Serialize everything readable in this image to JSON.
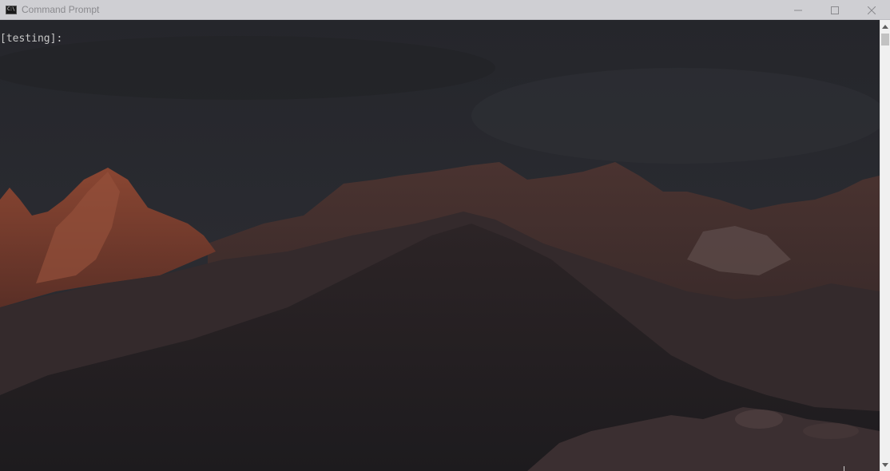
{
  "window": {
    "title": "Command Prompt",
    "icon": "cmd-app-icon",
    "icon_text": "C:\\",
    "controls": {
      "minimize": "minimize-icon",
      "maximize": "maximize-icon",
      "close": "close-icon"
    }
  },
  "console": {
    "prompt": "[testing]:",
    "background": "mountain-sunset-wallpaper"
  },
  "colors": {
    "titlebar": "#cfcfd3",
    "title_text": "#8a8a8e",
    "console_text": "#c8c8c8",
    "scrollbar": "#f0f0f0"
  }
}
